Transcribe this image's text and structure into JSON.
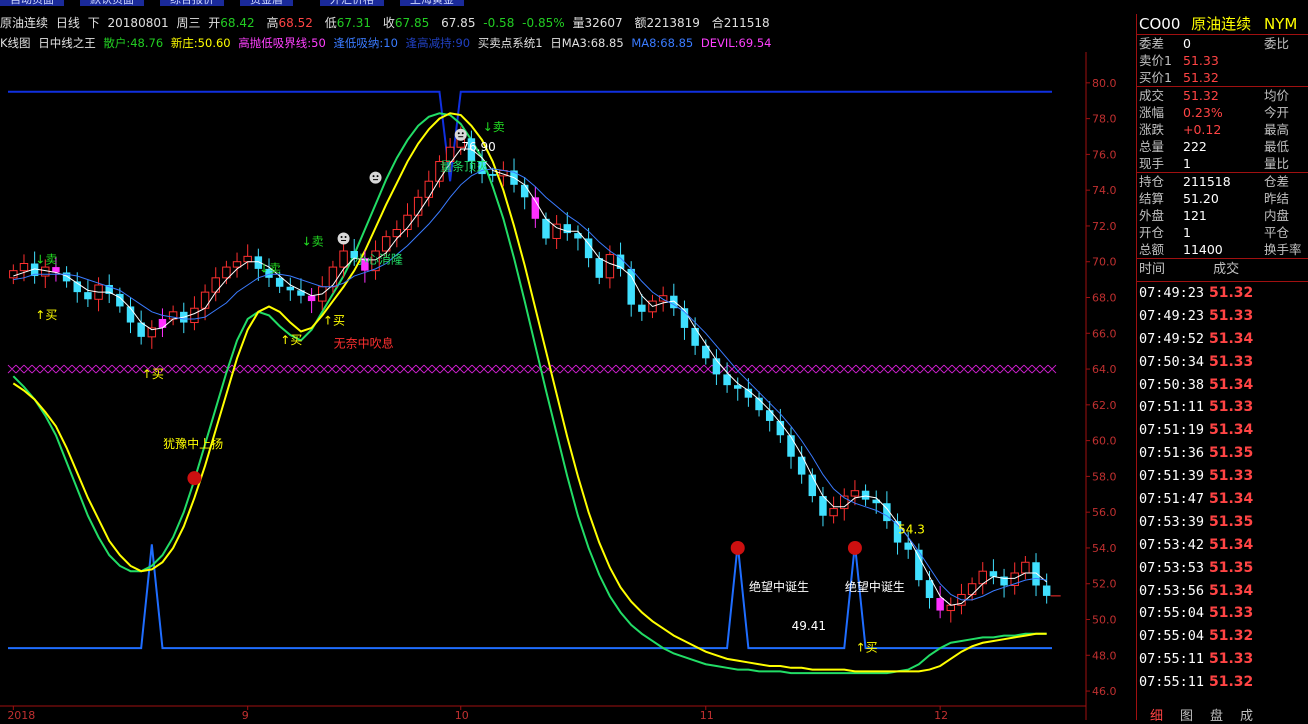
{
  "top_tabs": [
    "自动页面",
    "默认页面",
    "综合报价",
    "资金盾",
    "外汇价格",
    "上海黄金"
  ],
  "info": {
    "name": "原油连续",
    "period": "日线",
    "mode": "下",
    "date": "20180801",
    "weekday": "周三",
    "open_label": "开",
    "open": "68.42",
    "high_label": "高",
    "high": "68.52",
    "low_label": "低",
    "low": "67.31",
    "close_label": "收",
    "close": "67.85",
    "last": "67.85",
    "change": "-0.58",
    "change_pct": "-0.85%",
    "volume_label": "量",
    "volume": "32607",
    "amount_label": "额",
    "amount": "2213819",
    "oi_label": "合",
    "oi": "211518"
  },
  "indicators": {
    "kline": "K线图",
    "ind1": "日中线之王",
    "retail": "散户:48.76",
    "dealer": "新庄:50.60",
    "topbottom": "高抛低吸界线:50",
    "lowbuy": "逢低吸纳:10",
    "highsell": "逢高减持:90",
    "bsys": "买卖点系统1",
    "ma3": "日MA3:68.85",
    "ma8": "MA8:68.85",
    "devil": "DEVIL:69.54"
  },
  "colors": {
    "up": "#ff3030",
    "down": "#40e0ff",
    "ma_white": "#ffffff",
    "ma_blue": "#3a7bff",
    "curve_yellow": "#ffff00",
    "curve_green": "#22dd66",
    "signal_blue": "#1f6dff",
    "panel_border": "#a01010"
  },
  "chart_data": {
    "type": "candlestick",
    "ylim": [
      45.5,
      81.5
    ],
    "yticks": [
      "46.0",
      "48.0",
      "50.0",
      "52.0",
      "54.0",
      "56.0",
      "58.0",
      "60.0",
      "62.0",
      "64.0",
      "66.0",
      "68.0",
      "70.0",
      "72.0",
      "74.0",
      "76.0",
      "78.0",
      "80.0"
    ],
    "x_ticks": [
      {
        "label": "2018",
        "i": 0
      },
      {
        "label": "9",
        "i": 22
      },
      {
        "label": "10",
        "i": 42
      },
      {
        "label": "11",
        "i": 65
      },
      {
        "label": "12",
        "i": 87
      }
    ],
    "n_bars": 98,
    "closes": [
      69.5,
      69.9,
      69.2,
      69.7,
      69.4,
      68.9,
      68.3,
      67.9,
      68.7,
      68.2,
      67.5,
      66.6,
      65.8,
      66.3,
      66.8,
      67.2,
      66.6,
      67.4,
      68.3,
      69.1,
      69.7,
      70.0,
      70.3,
      69.6,
      69.1,
      68.6,
      68.4,
      68.1,
      67.8,
      68.6,
      69.7,
      70.6,
      70.2,
      69.5,
      70.6,
      71.4,
      71.8,
      72.6,
      73.6,
      74.5,
      75.6,
      76.4,
      76.9,
      75.6,
      74.9,
      74.8,
      75.1,
      74.3,
      73.6,
      72.4,
      71.3,
      72.1,
      71.6,
      71.3,
      70.2,
      69.1,
      70.4,
      69.6,
      67.6,
      67.2,
      67.8,
      68.1,
      67.4,
      66.3,
      65.3,
      64.6,
      63.7,
      63.1,
      62.9,
      62.4,
      61.7,
      61.1,
      60.3,
      59.1,
      58.1,
      56.9,
      55.8,
      56.2,
      56.9,
      57.2,
      56.7,
      56.5,
      55.5,
      54.3,
      53.9,
      52.2,
      51.2,
      50.5,
      50.8,
      51.4,
      52.0,
      52.7,
      52.4,
      51.9,
      52.6,
      53.2,
      51.9,
      51.32
    ],
    "opens": [
      69.1,
      69.5,
      69.9,
      69.2,
      69.7,
      69.4,
      68.9,
      68.3,
      67.9,
      68.7,
      68.2,
      67.5,
      66.6,
      65.8,
      66.3,
      66.8,
      67.2,
      66.6,
      67.4,
      68.3,
      69.1,
      69.7,
      70.0,
      70.3,
      69.6,
      69.1,
      68.6,
      68.4,
      68.1,
      67.8,
      68.6,
      69.7,
      70.6,
      70.2,
      69.5,
      70.6,
      71.4,
      71.8,
      72.6,
      73.6,
      74.5,
      75.6,
      76.4,
      76.9,
      75.6,
      74.9,
      74.8,
      75.1,
      74.3,
      73.6,
      72.4,
      71.3,
      72.1,
      71.6,
      71.3,
      70.2,
      69.1,
      70.4,
      69.6,
      67.6,
      67.2,
      67.8,
      68.1,
      67.4,
      66.3,
      65.3,
      64.6,
      63.7,
      63.1,
      62.9,
      62.4,
      61.7,
      61.1,
      60.3,
      59.1,
      58.1,
      56.9,
      55.8,
      56.2,
      56.9,
      57.2,
      56.7,
      56.5,
      55.5,
      54.3,
      53.9,
      52.2,
      51.2,
      50.5,
      50.8,
      51.4,
      52.0,
      52.7,
      52.4,
      51.9,
      52.6,
      53.2,
      51.9
    ],
    "pink_bars": [
      4,
      14,
      28,
      33,
      49,
      87
    ],
    "ma_white": [
      69.2,
      69.4,
      69.6,
      69.5,
      69.4,
      69.2,
      68.8,
      68.4,
      68.3,
      68.3,
      68.0,
      67.4,
      66.6,
      66.2,
      66.3,
      66.8,
      66.9,
      67.1,
      67.4,
      68.3,
      69.0,
      69.6,
      70.0,
      70.0,
      69.7,
      69.2,
      68.7,
      68.4,
      68.1,
      68.2,
      68.7,
      69.6,
      70.2,
      70.1,
      70.1,
      70.5,
      71.3,
      71.9,
      72.7,
      73.6,
      74.6,
      75.5,
      76.3,
      76.3,
      75.8,
      75.1,
      74.9,
      74.7,
      74.3,
      73.4,
      72.4,
      71.9,
      71.7,
      71.7,
      71.0,
      70.2,
      69.9,
      69.7,
      69.2,
      68.1,
      67.5,
      67.7,
      67.8,
      67.3,
      66.3,
      65.4,
      64.5,
      63.8,
      63.2,
      62.8,
      62.3,
      61.7,
      61.0,
      60.2,
      59.2,
      58.0,
      56.9,
      56.3,
      56.3,
      56.8,
      56.9,
      56.8,
      56.2,
      55.4,
      54.6,
      53.5,
      52.4,
      51.3,
      50.8,
      50.9,
      51.4,
      52.0,
      52.4,
      52.3,
      52.3,
      52.6,
      52.6,
      52.1
    ],
    "ma_blue": [
      69.0,
      69.1,
      69.3,
      69.3,
      69.3,
      69.3,
      69.2,
      69.0,
      68.8,
      68.6,
      68.4,
      68.0,
      67.6,
      67.2,
      67.0,
      66.9,
      66.8,
      66.8,
      66.9,
      67.3,
      67.7,
      68.3,
      68.7,
      69.1,
      69.3,
      69.3,
      69.2,
      69.0,
      68.8,
      68.6,
      68.6,
      68.8,
      69.2,
      69.4,
      69.6,
      69.9,
      70.4,
      70.9,
      71.5,
      72.1,
      72.8,
      73.6,
      74.3,
      74.8,
      75.1,
      75.2,
      75.1,
      75.0,
      74.7,
      74.2,
      73.6,
      73.1,
      72.6,
      72.2,
      71.7,
      71.1,
      70.6,
      70.2,
      69.6,
      68.9,
      68.3,
      67.9,
      67.6,
      67.2,
      66.6,
      66.0,
      65.3,
      64.6,
      63.9,
      63.3,
      62.7,
      62.1,
      61.5,
      60.8,
      60.0,
      59.1,
      58.1,
      57.3,
      56.8,
      56.5,
      56.3,
      56.1,
      55.8,
      55.3,
      54.6,
      53.8,
      52.9,
      52.0,
      51.4,
      51.1,
      51.1,
      51.3,
      51.6,
      51.8,
      52.0,
      52.2,
      52.3,
      52.2
    ],
    "curve_yellow": [
      63.2,
      62.8,
      62.3,
      61.6,
      60.8,
      59.6,
      58.2,
      56.8,
      55.6,
      54.4,
      53.6,
      53.0,
      52.7,
      52.8,
      53.2,
      54.0,
      55.2,
      56.8,
      58.6,
      60.6,
      62.6,
      64.6,
      66.2,
      67.2,
      67.5,
      67.2,
      66.6,
      66.1,
      66.3,
      67.0,
      67.8,
      68.6,
      69.5,
      70.6,
      71.9,
      73.2,
      74.4,
      75.6,
      76.6,
      77.4,
      78.0,
      78.3,
      78.2,
      77.6,
      76.8,
      75.6,
      74.0,
      72.0,
      69.8,
      67.4,
      65.0,
      62.6,
      60.2,
      58.0,
      56.0,
      54.3,
      52.9,
      51.8,
      51.0,
      50.4,
      49.9,
      49.5,
      49.1,
      48.8,
      48.5,
      48.2,
      48.0,
      47.8,
      47.7,
      47.6,
      47.5,
      47.4,
      47.4,
      47.3,
      47.3,
      47.2,
      47.2,
      47.2,
      47.2,
      47.1,
      47.1,
      47.1,
      47.1,
      47.1,
      47.1,
      47.1,
      47.2,
      47.4,
      47.8,
      48.2,
      48.5,
      48.7,
      48.8,
      48.9,
      49.0,
      49.1,
      49.2,
      49.2
    ],
    "curve_green": [
      63.6,
      63.0,
      62.3,
      61.4,
      60.3,
      58.8,
      57.3,
      55.8,
      54.6,
      53.6,
      53.0,
      52.7,
      52.7,
      53.0,
      53.6,
      54.6,
      56.0,
      57.8,
      59.8,
      61.8,
      63.8,
      65.6,
      66.8,
      67.2,
      67.0,
      66.4,
      65.9,
      65.6,
      66.2,
      67.2,
      68.2,
      69.2,
      70.4,
      71.8,
      73.2,
      74.6,
      75.8,
      76.8,
      77.6,
      78.1,
      78.3,
      78.2,
      77.7,
      76.8,
      75.8,
      74.2,
      72.4,
      70.2,
      67.8,
      65.3,
      62.8,
      60.4,
      58.0,
      55.8,
      54.0,
      52.5,
      51.3,
      50.4,
      49.7,
      49.2,
      48.8,
      48.4,
      48.1,
      47.9,
      47.7,
      47.5,
      47.4,
      47.3,
      47.2,
      47.2,
      47.1,
      47.1,
      47.1,
      47.0,
      47.0,
      47.0,
      47.0,
      47.0,
      47.0,
      47.0,
      47.0,
      47.0,
      47.0,
      47.1,
      47.2,
      47.5,
      48.0,
      48.4,
      48.7,
      48.8,
      48.9,
      49.0,
      49.0,
      49.1,
      49.1,
      49.2,
      49.2,
      49.2
    ],
    "level_magenta": 64.0,
    "signal_top_level": 79.5,
    "signal_base_level": 48.4,
    "signal_spikes": [
      {
        "i": 13,
        "peak": 54.2
      },
      {
        "i": 68,
        "peak": 54.2
      },
      {
        "i": 79,
        "peak": 54.2
      }
    ],
    "annotations": [
      {
        "text": "↓卖",
        "i": 3,
        "y": 69.9,
        "color": "#22dd22"
      },
      {
        "text": "↑买",
        "i": 3,
        "y": 66.8,
        "color": "#ffff00"
      },
      {
        "text": "↑买",
        "i": 13,
        "y": 63.5,
        "color": "#ffff00"
      },
      {
        "text": "↓卖",
        "i": 24,
        "y": 69.4,
        "color": "#22dd22"
      },
      {
        "text": "↑买",
        "i": 26,
        "y": 65.4,
        "color": "#ffff00"
      },
      {
        "text": "↓卖",
        "i": 28,
        "y": 70.9,
        "color": "#22dd22"
      },
      {
        "text": "↑买",
        "i": 30,
        "y": 66.5,
        "color": "#ffff00"
      },
      {
        "text": "无奈中吹息",
        "i": 31,
        "y": 65.2,
        "color": "#ff3030"
      },
      {
        "text": "小心消隆",
        "i": 33,
        "y": 69.9,
        "color": "#22dd66"
      },
      {
        "text": "犹豫中上扬",
        "i": 15,
        "y": 59.6,
        "color": "#ffff00"
      },
      {
        "text": "量条顶灭",
        "i": 41,
        "y": 75.1,
        "color": "#22dd66"
      },
      {
        "text": "76.90",
        "i": 43,
        "y": 76.2,
        "color": "#ffffff"
      },
      {
        "text": "↓卖",
        "i": 45,
        "y": 77.3,
        "color": "#22dd22"
      },
      {
        "text": "绝望中诞生",
        "i": 70,
        "y": 51.6,
        "color": "#ffffff"
      },
      {
        "text": "绝望中诞生",
        "i": 79,
        "y": 51.6,
        "color": "#ffffff"
      },
      {
        "text": "49.41",
        "i": 74,
        "y": 49.4,
        "color": "#ffffff"
      },
      {
        "text": "54.3",
        "i": 84,
        "y": 54.8,
        "color": "#ffff00"
      },
      {
        "text": "↑买",
        "i": 80,
        "y": 48.2,
        "color": "#ffff00"
      }
    ],
    "smileys": [
      {
        "i": 34,
        "y": 74.7
      },
      {
        "i": 31,
        "y": 71.3
      },
      {
        "i": 42,
        "y": 77.1
      }
    ],
    "red_dots": [
      {
        "i": 17,
        "y": 57.9
      },
      {
        "i": 68,
        "y": 54.0
      },
      {
        "i": 79,
        "y": 54.0
      }
    ]
  },
  "right_panel": {
    "code": "CO00",
    "name": "原油连续",
    "exchange": "NYM",
    "rows": [
      {
        "label": "委差",
        "value": "0",
        "right": "委比",
        "vcolor": "#ffffff"
      },
      {
        "label": "卖价1",
        "value": "51.33",
        "right": "",
        "vcolor": "#ff4444"
      },
      {
        "label": "买价1",
        "value": "51.32",
        "right": "",
        "vcolor": "#ff4444"
      },
      {
        "label": "成交",
        "value": "51.32",
        "right": "均价",
        "vcolor": "#ff4444"
      },
      {
        "label": "涨幅",
        "value": "0.23%",
        "right": "今开",
        "vcolor": "#ff4444"
      },
      {
        "label": "涨跌",
        "value": "+0.12",
        "right": "最高",
        "vcolor": "#ff4444"
      },
      {
        "label": "总量",
        "value": "222",
        "right": "最低",
        "vcolor": "#ffffff"
      },
      {
        "label": "现手",
        "value": "1",
        "right": "量比",
        "vcolor": "#ffffff"
      },
      {
        "label": "持仓",
        "value": "211518",
        "right": "仓差",
        "vcolor": "#ffffff"
      },
      {
        "label": "结算",
        "value": "51.20",
        "right": "昨结",
        "vcolor": "#ffffff"
      },
      {
        "label": "外盘",
        "value": "121",
        "right": "内盘",
        "vcolor": "#ffffff"
      },
      {
        "label": "开仓",
        "value": "1",
        "right": "平仓",
        "vcolor": "#ffffff"
      },
      {
        "label": "总额",
        "value": "11400",
        "right": "换手率",
        "vcolor": "#ffffff"
      }
    ],
    "ticks_header": {
      "time": "时间",
      "price": "成交"
    },
    "ticks": [
      {
        "time": "07:49:23",
        "price": "51.32"
      },
      {
        "time": "07:49:23",
        "price": "51.33"
      },
      {
        "time": "07:49:52",
        "price": "51.34"
      },
      {
        "time": "07:50:34",
        "price": "51.33"
      },
      {
        "time": "07:50:38",
        "price": "51.34"
      },
      {
        "time": "07:51:11",
        "price": "51.33"
      },
      {
        "time": "07:51:19",
        "price": "51.34"
      },
      {
        "time": "07:51:36",
        "price": "51.35"
      },
      {
        "time": "07:51:39",
        "price": "51.33"
      },
      {
        "time": "07:51:47",
        "price": "51.34"
      },
      {
        "time": "07:53:39",
        "price": "51.35"
      },
      {
        "time": "07:53:42",
        "price": "51.34"
      },
      {
        "time": "07:53:53",
        "price": "51.35"
      },
      {
        "time": "07:53:56",
        "price": "51.34"
      },
      {
        "time": "07:55:04",
        "price": "51.33"
      },
      {
        "time": "07:55:04",
        "price": "51.32"
      },
      {
        "time": "07:55:11",
        "price": "51.33"
      },
      {
        "time": "07:55:11",
        "price": "51.32"
      }
    ],
    "bottom_tabs": [
      "细",
      "图",
      "盘",
      "成"
    ]
  }
}
